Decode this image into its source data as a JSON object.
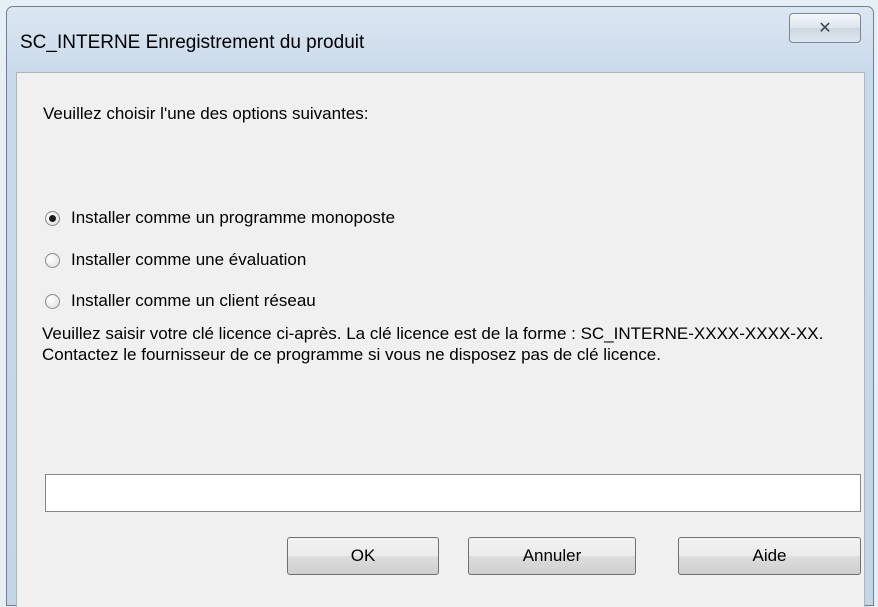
{
  "window": {
    "title": "SC_INTERNE Enregistrement du produit",
    "close_label": "✕"
  },
  "dialog": {
    "prompt": "Veuillez choisir l'une des options suivantes:",
    "options": [
      {
        "label": "Installer comme un programme monoposte",
        "checked": true
      },
      {
        "label": "Installer comme une évaluation",
        "checked": false
      },
      {
        "label": "Installer comme un client réseau",
        "checked": false
      }
    ],
    "info_text": "Veuillez saisir votre clé licence ci-après. La clé licence est de la forme : SC_INTERNE-XXXX-XXXX-XX. Contactez le fournisseur de ce programme si vous ne disposez pas de clé licence.",
    "license_value": ""
  },
  "buttons": {
    "ok": "OK",
    "cancel": "Annuler",
    "help": "Aide"
  }
}
